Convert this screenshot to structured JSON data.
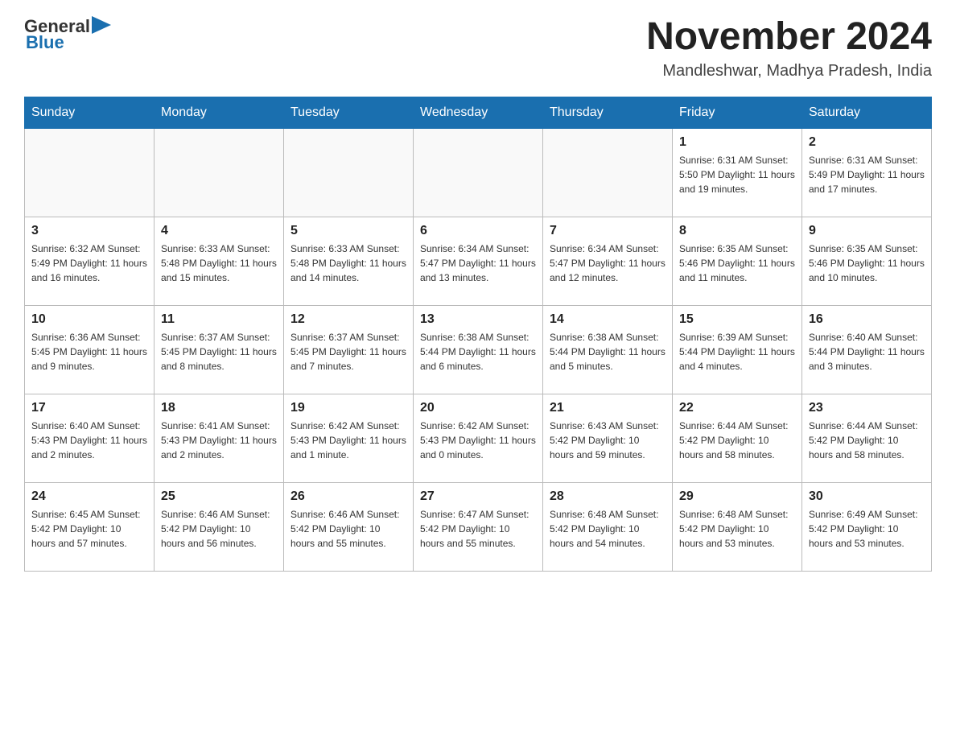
{
  "header": {
    "logo_general": "General",
    "logo_blue": "Blue",
    "month_year": "November 2024",
    "location": "Mandleshwar, Madhya Pradesh, India"
  },
  "days_of_week": [
    "Sunday",
    "Monday",
    "Tuesday",
    "Wednesday",
    "Thursday",
    "Friday",
    "Saturday"
  ],
  "weeks": [
    [
      {
        "day": "",
        "info": ""
      },
      {
        "day": "",
        "info": ""
      },
      {
        "day": "",
        "info": ""
      },
      {
        "day": "",
        "info": ""
      },
      {
        "day": "",
        "info": ""
      },
      {
        "day": "1",
        "info": "Sunrise: 6:31 AM\nSunset: 5:50 PM\nDaylight: 11 hours and 19 minutes."
      },
      {
        "day": "2",
        "info": "Sunrise: 6:31 AM\nSunset: 5:49 PM\nDaylight: 11 hours and 17 minutes."
      }
    ],
    [
      {
        "day": "3",
        "info": "Sunrise: 6:32 AM\nSunset: 5:49 PM\nDaylight: 11 hours and 16 minutes."
      },
      {
        "day": "4",
        "info": "Sunrise: 6:33 AM\nSunset: 5:48 PM\nDaylight: 11 hours and 15 minutes."
      },
      {
        "day": "5",
        "info": "Sunrise: 6:33 AM\nSunset: 5:48 PM\nDaylight: 11 hours and 14 minutes."
      },
      {
        "day": "6",
        "info": "Sunrise: 6:34 AM\nSunset: 5:47 PM\nDaylight: 11 hours and 13 minutes."
      },
      {
        "day": "7",
        "info": "Sunrise: 6:34 AM\nSunset: 5:47 PM\nDaylight: 11 hours and 12 minutes."
      },
      {
        "day": "8",
        "info": "Sunrise: 6:35 AM\nSunset: 5:46 PM\nDaylight: 11 hours and 11 minutes."
      },
      {
        "day": "9",
        "info": "Sunrise: 6:35 AM\nSunset: 5:46 PM\nDaylight: 11 hours and 10 minutes."
      }
    ],
    [
      {
        "day": "10",
        "info": "Sunrise: 6:36 AM\nSunset: 5:45 PM\nDaylight: 11 hours and 9 minutes."
      },
      {
        "day": "11",
        "info": "Sunrise: 6:37 AM\nSunset: 5:45 PM\nDaylight: 11 hours and 8 minutes."
      },
      {
        "day": "12",
        "info": "Sunrise: 6:37 AM\nSunset: 5:45 PM\nDaylight: 11 hours and 7 minutes."
      },
      {
        "day": "13",
        "info": "Sunrise: 6:38 AM\nSunset: 5:44 PM\nDaylight: 11 hours and 6 minutes."
      },
      {
        "day": "14",
        "info": "Sunrise: 6:38 AM\nSunset: 5:44 PM\nDaylight: 11 hours and 5 minutes."
      },
      {
        "day": "15",
        "info": "Sunrise: 6:39 AM\nSunset: 5:44 PM\nDaylight: 11 hours and 4 minutes."
      },
      {
        "day": "16",
        "info": "Sunrise: 6:40 AM\nSunset: 5:44 PM\nDaylight: 11 hours and 3 minutes."
      }
    ],
    [
      {
        "day": "17",
        "info": "Sunrise: 6:40 AM\nSunset: 5:43 PM\nDaylight: 11 hours and 2 minutes."
      },
      {
        "day": "18",
        "info": "Sunrise: 6:41 AM\nSunset: 5:43 PM\nDaylight: 11 hours and 2 minutes."
      },
      {
        "day": "19",
        "info": "Sunrise: 6:42 AM\nSunset: 5:43 PM\nDaylight: 11 hours and 1 minute."
      },
      {
        "day": "20",
        "info": "Sunrise: 6:42 AM\nSunset: 5:43 PM\nDaylight: 11 hours and 0 minutes."
      },
      {
        "day": "21",
        "info": "Sunrise: 6:43 AM\nSunset: 5:42 PM\nDaylight: 10 hours and 59 minutes."
      },
      {
        "day": "22",
        "info": "Sunrise: 6:44 AM\nSunset: 5:42 PM\nDaylight: 10 hours and 58 minutes."
      },
      {
        "day": "23",
        "info": "Sunrise: 6:44 AM\nSunset: 5:42 PM\nDaylight: 10 hours and 58 minutes."
      }
    ],
    [
      {
        "day": "24",
        "info": "Sunrise: 6:45 AM\nSunset: 5:42 PM\nDaylight: 10 hours and 57 minutes."
      },
      {
        "day": "25",
        "info": "Sunrise: 6:46 AM\nSunset: 5:42 PM\nDaylight: 10 hours and 56 minutes."
      },
      {
        "day": "26",
        "info": "Sunrise: 6:46 AM\nSunset: 5:42 PM\nDaylight: 10 hours and 55 minutes."
      },
      {
        "day": "27",
        "info": "Sunrise: 6:47 AM\nSunset: 5:42 PM\nDaylight: 10 hours and 55 minutes."
      },
      {
        "day": "28",
        "info": "Sunrise: 6:48 AM\nSunset: 5:42 PM\nDaylight: 10 hours and 54 minutes."
      },
      {
        "day": "29",
        "info": "Sunrise: 6:48 AM\nSunset: 5:42 PM\nDaylight: 10 hours and 53 minutes."
      },
      {
        "day": "30",
        "info": "Sunrise: 6:49 AM\nSunset: 5:42 PM\nDaylight: 10 hours and 53 minutes."
      }
    ]
  ]
}
